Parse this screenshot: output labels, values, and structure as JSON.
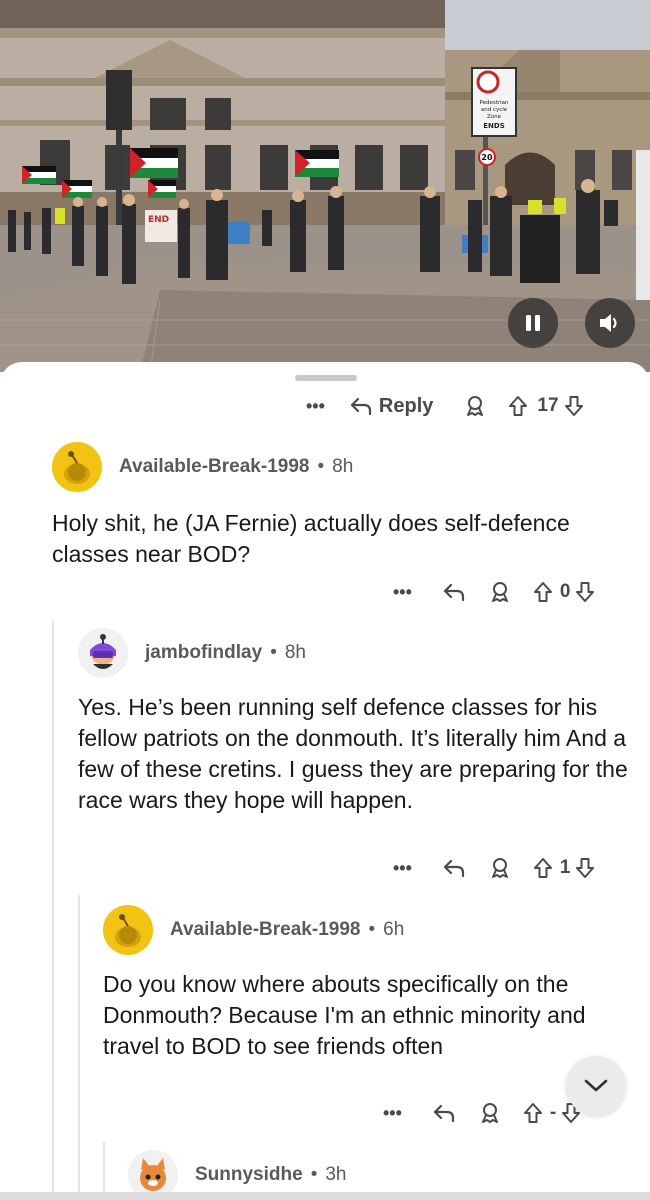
{
  "video": {
    "sign_lines": [
      "Pedestrian",
      "and cycle",
      "Zone",
      "ENDS"
    ],
    "speed_sign": "20",
    "banner_text": "END",
    "pause_icon": "pause-icon",
    "sound_icon": "speaker-icon"
  },
  "post_actions": {
    "more": "•••",
    "reply_label": "Reply",
    "award_icon": "award-icon",
    "vote_count": "17"
  },
  "comments": [
    {
      "username": "Available-Break-1998",
      "separator": "•",
      "age": "8h",
      "text": "Holy shit, he (JA Fernie) actually does self-defence classes near BOD?",
      "more": "•••",
      "vote_count": "0"
    },
    {
      "username": "jambofindlay",
      "separator": "•",
      "age": "8h",
      "text": "Yes. He’s been running self defence classes for his fellow patriots on the donmouth. It’s literally him And a few of these cretins. I guess they are preparing for the race wars they hope will happen.",
      "more": "•••",
      "vote_count": "1"
    },
    {
      "username": "Available-Break-1998",
      "separator": "•",
      "age": "6h",
      "text": "Do you know where abouts specifically on the Donmouth? Because I'm an ethnic minority and travel to BOD to see friends often",
      "more": "•••",
      "vote_count": "-"
    },
    {
      "username": "Sunnysidhe",
      "separator": "•",
      "age": "3h"
    }
  ],
  "fab": {
    "icon": "chevron-down-icon"
  },
  "colors": {
    "text": "#1a1a1b",
    "meta": "#5a5a5a",
    "icon": "#4a4a4a",
    "snoo_yellow": "#f2c312",
    "thread_line": "#e4e4e4"
  }
}
